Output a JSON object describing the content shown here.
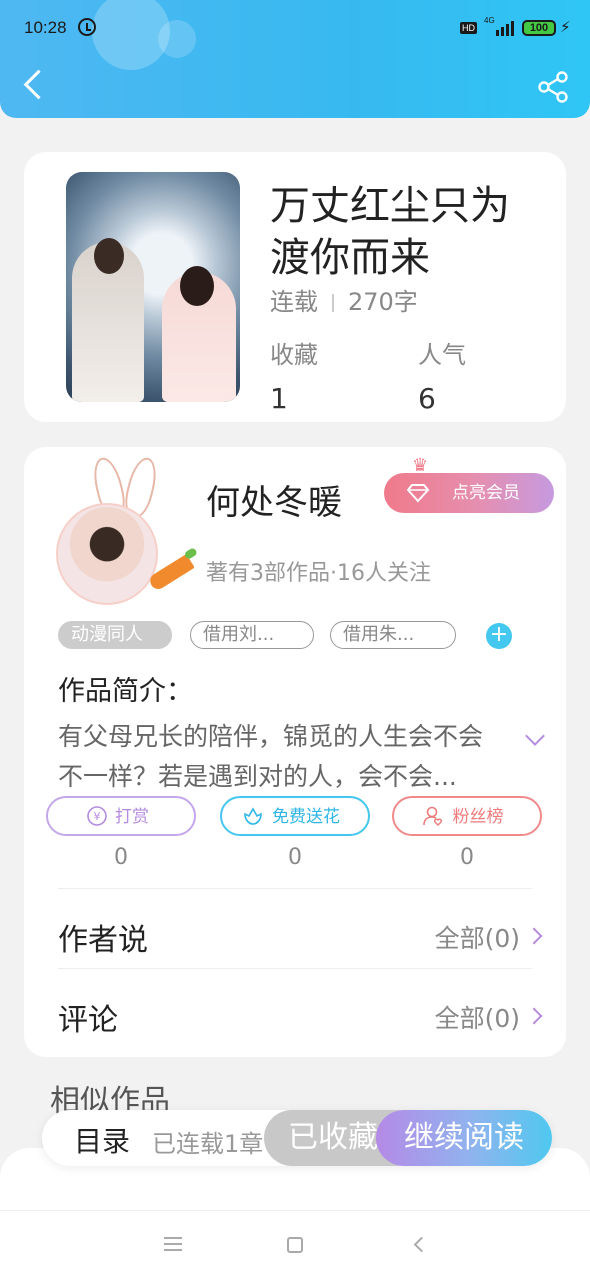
{
  "status_bar": {
    "time": "10:28",
    "hd": "HD",
    "network": "4G",
    "battery": "100"
  },
  "book": {
    "title": "万丈红尘只为渡你而来",
    "status": "连载",
    "word_count": "270字",
    "favorites_label": "收藏",
    "favorites_value": "1",
    "popularity_label": "人气",
    "popularity_value": "6"
  },
  "author": {
    "name": "何处冬暖",
    "vip_label": "点亮会员",
    "info": "著有3部作品·16人关注"
  },
  "tags": {
    "items": [
      "动漫同人",
      "借用刘...",
      "借用朱..."
    ],
    "add": "+"
  },
  "intro": {
    "label": "作品简介：",
    "text": "有父母兄长的陪伴，锦觅的人生会不会不一样？若是遇到对的人，会不会..."
  },
  "actions": [
    {
      "label": "打赏",
      "count": "0"
    },
    {
      "label": "免费送花",
      "count": "0"
    },
    {
      "label": "粉丝榜",
      "count": "0"
    }
  ],
  "rows": {
    "author_says": {
      "label": "作者说",
      "right": "全部(0)"
    },
    "comments": {
      "label": "评论",
      "right": "全部(0)"
    }
  },
  "similar": {
    "title": "相似作品"
  },
  "bottom_bar": {
    "toc": "目录",
    "toc_sub": "已连载1章",
    "favorited": "已收藏",
    "continue": "继续阅读"
  },
  "colors": {
    "header_gradient": [
      "#4fb8f2",
      "#2fc6f5"
    ],
    "vip_gradient": [
      "#f07a8a",
      "#c69adf"
    ],
    "read_gradient": [
      "#b58ae6",
      "#4fc8ef"
    ],
    "accent_purple": "#b48ce0",
    "accent_cyan": "#44c7ee",
    "accent_red": "#ee7b7b"
  },
  "icons": [
    "back-icon",
    "share-icon",
    "crown-icon",
    "diamond-icon",
    "plus-icon",
    "chevron-down-icon",
    "yen-icon",
    "flower-icon",
    "fan-icon",
    "chevron-right-icon"
  ]
}
